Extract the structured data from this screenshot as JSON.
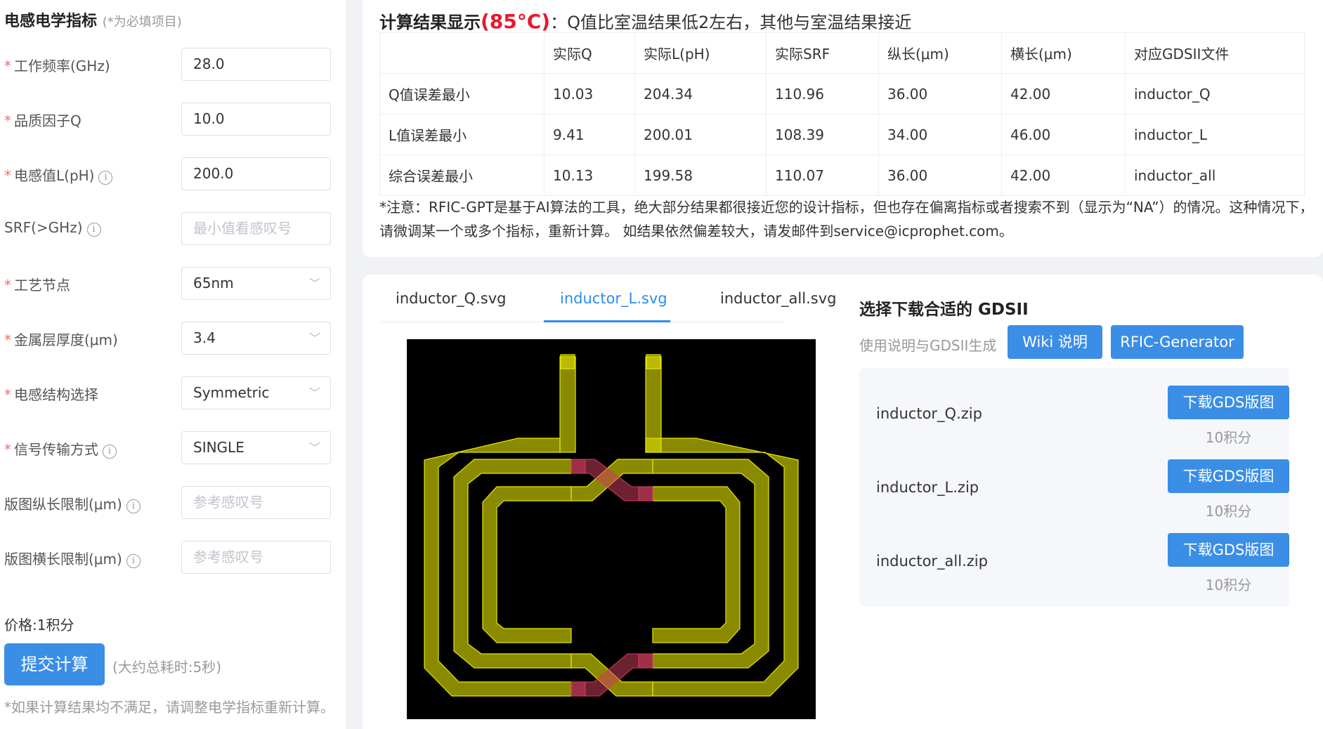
{
  "form": {
    "title": "电感电学指标",
    "required_note": "(*为必填项目)",
    "fields": [
      {
        "label": "工作频率(GHz)",
        "value": "28.0",
        "required": true
      },
      {
        "label": "品质因子Q",
        "value": "10.0",
        "required": true
      },
      {
        "label": "电感值L(pH)",
        "value": "200.0",
        "required": true
      },
      {
        "label": "SRF(>GHz)",
        "placeholder": "最小值看感叹号",
        "required": false
      },
      {
        "label": "工艺节点",
        "value": "65nm",
        "required": true
      },
      {
        "label": "金属层厚度(μm)",
        "value": "3.4",
        "required": true
      },
      {
        "label": "电感结构选择",
        "value": "Symmetric",
        "required": true
      },
      {
        "label": "信号传输方式",
        "value": "SINGLE",
        "required": true
      },
      {
        "label": "版图纵长限制(μm)",
        "placeholder": "参考感叹号",
        "required": false
      },
      {
        "label": "版图横长限制(μm)",
        "placeholder": "参考感叹号",
        "required": false
      }
    ],
    "price": "价格:1积分",
    "submit_label": "提交计算",
    "time_hint": "(大约总耗时:5秒)",
    "bottom_note": "*如果计算结果均不满足，请调整电学指标重新计算。"
  },
  "results": {
    "title_prefix": "计算结果显示",
    "title_temp": "(85°C)",
    "title_suffix": "：Q值比室温结果低2左右，其他与室温结果接近",
    "columns": [
      "",
      "实际Q",
      "实际L(pH)",
      "实际SRF",
      "纵长(μm)",
      "横长(μm)",
      "对应GDSII文件"
    ],
    "rows": [
      [
        "Q值误差最小",
        "10.03",
        "204.34",
        "110.96",
        "36.00",
        "42.00",
        "inductor_Q"
      ],
      [
        "L值误差最小",
        "9.41",
        "200.01",
        "108.39",
        "34.00",
        "46.00",
        "inductor_L"
      ],
      [
        "综合误差最小",
        "10.13",
        "199.58",
        "110.07",
        "36.00",
        "42.00",
        "inductor_all"
      ]
    ],
    "note": "*注意：RFIC-GPT是基于AI算法的工具，绝大部分结果都很接近您的设计指标，但也存在偏离指标或者搜索不到（显示为“NA”）的情况。这种情况下，请微调某一个或多个指标，重新计算。 如结果依然偏差较大，请发邮件到service@icprophet.com。"
  },
  "viewer": {
    "tabs": [
      "inductor_Q.svg",
      "inductor_L.svg",
      "inductor_all.svg"
    ],
    "active_tab": "inductor_L.svg"
  },
  "downloads": {
    "title": "选择下载合适的 GDSII",
    "usage_label": "使用说明与GDSII生成",
    "wiki_label": "Wiki 说明",
    "generator_label": "RFIC-Generator",
    "items": [
      {
        "file": "inductor_Q.zip",
        "button": "下载GDS版图",
        "cost": "10积分"
      },
      {
        "file": "inductor_L.zip",
        "button": "下载GDS版图",
        "cost": "10积分"
      },
      {
        "file": "inductor_all.zip",
        "button": "下载GDS版图",
        "cost": "10积分"
      }
    ]
  },
  "colors": {
    "primary": "#3a8ee6",
    "active_tab": "#2d8cf0",
    "required_star": "#f56c6c",
    "temp_highlight": "#e8192c",
    "metal": "#9a9a00",
    "via": "#b8472f"
  }
}
